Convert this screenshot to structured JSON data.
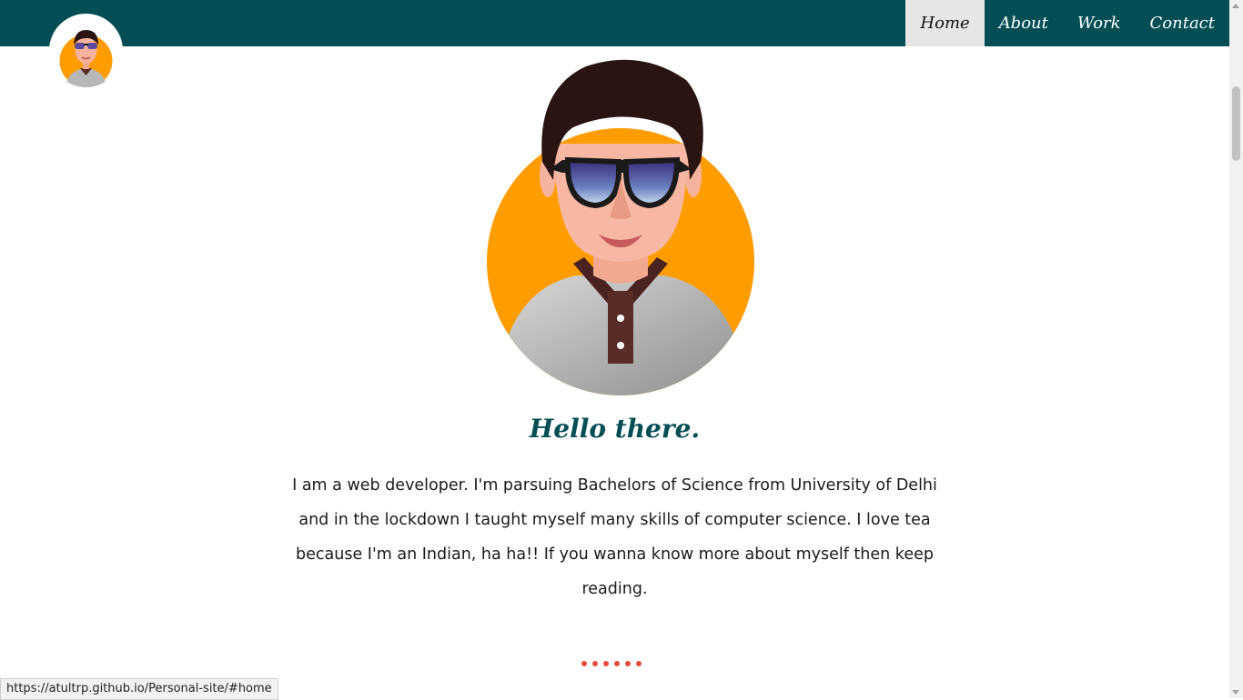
{
  "nav": {
    "links": [
      {
        "label": "Home",
        "active": true
      },
      {
        "label": "About",
        "active": false
      },
      {
        "label": "Work",
        "active": false
      },
      {
        "label": "Contact",
        "active": false
      }
    ]
  },
  "hero": {
    "greeting": "Hello there.",
    "intro": "I am a web developer. I'm parsuing Bachelors of Science from University of Delhi and in the lockdown I taught myself many skills of computer science. I love tea because I'm an Indian, ha ha!! If you wanna know more about myself then keep reading."
  },
  "scroll_indicator": {
    "dot_count": 6
  },
  "status_bar": {
    "url": "https://atultrp.github.io/Personal-site/#home"
  },
  "colors": {
    "nav_bg": "#034e55",
    "nav_active_bg": "#e6e6e6",
    "avatar_circle": "#ff9c00",
    "heading": "#034e55",
    "dots": "#e74c3c"
  }
}
